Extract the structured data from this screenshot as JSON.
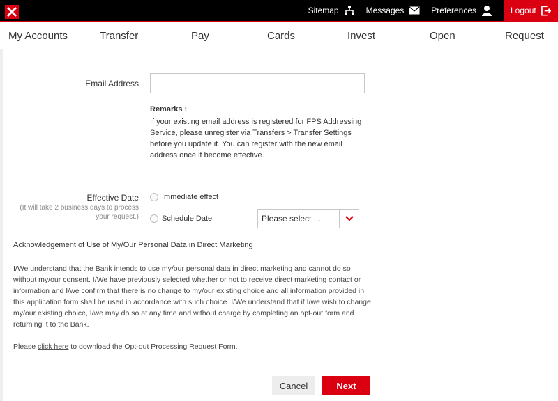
{
  "topbar": {
    "links": [
      {
        "label": "Sitemap",
        "icon": "sitemap-icon"
      },
      {
        "label": "Messages",
        "icon": "envelope-icon"
      },
      {
        "label": "Preferences",
        "icon": "user-icon"
      },
      {
        "label": "Logout",
        "icon": "logout-icon"
      }
    ],
    "logo_icon": "bank-logo"
  },
  "nav": {
    "items": [
      "My Accounts",
      "Transfer",
      "Pay",
      "Cards",
      "Invest",
      "Open",
      "Request"
    ]
  },
  "form": {
    "email_label": "Email Address",
    "email_value": "",
    "remarks_title": "Remarks :",
    "remarks_body": "If your existing email address is registered for FPS Addressing Service, please unregister via Transfers > Transfer Settings before you update it. You can register with the new email address once it become effective.",
    "effective_date_label": "Effective Date",
    "effective_date_note": "(It will take 2 business days to process your request.)",
    "option_immediate": "Immediate effect",
    "option_schedule": "Schedule Date",
    "schedule_select_value": "Please select ..."
  },
  "acknowledgement": {
    "title": "Acknowledgement of Use of My/Our Personal Data in Direct Marketing",
    "body": "I/We understand that the Bank intends to use my/our personal data in direct marketing and cannot do so without my/our consent. I/We have previously selected whether or not to receive direct marketing contact or information and I/we confirm that there is no change to my/our existing choice and all information provided in this application form shall be used in accordance with such choice. I/We understand that if I/we wish to change my/our existing choice, I/we may do so at any time and without charge by completing an opt-out form and returning it to the Bank.",
    "link_prefix": "Please ",
    "link_text": "click here",
    "link_suffix": " to download the Opt-out Processing Request Form."
  },
  "buttons": {
    "cancel": "Cancel",
    "next": "Next"
  },
  "colors": {
    "brand_red": "#db0011",
    "topbar_bg": "#000000"
  }
}
